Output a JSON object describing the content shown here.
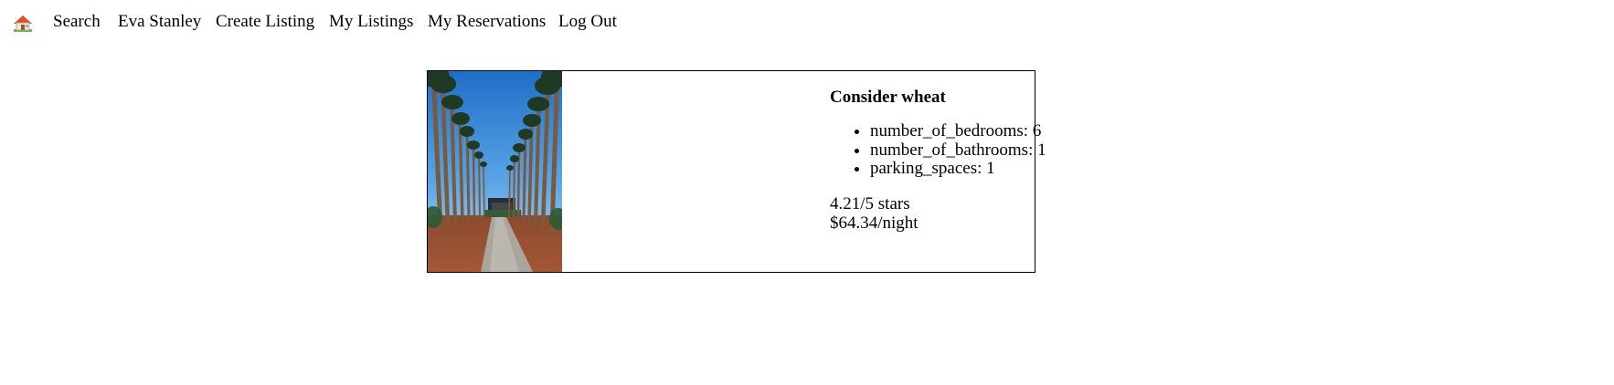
{
  "nav": {
    "home_icon": "home-icon",
    "links": [
      "Search",
      "Eva Stanley",
      "Create Listing",
      "My Listings",
      "My Reservations",
      "Log Out"
    ]
  },
  "listing": {
    "title": "Consider wheat",
    "features": [
      "number_of_bedrooms: 6",
      "number_of_bathrooms: 1",
      "parking_spaces: 1"
    ],
    "rating": "4.21/5 stars",
    "price": "$64.34/night"
  },
  "colors": {
    "sky": "#2f7fd0",
    "palm_trunk": "#7a5a3c",
    "palm_leaf": "#1f3a24",
    "soil": "#9a4f32",
    "path": "#a9a39b",
    "house": "#2a2f32",
    "roof_home": "#e24a2b",
    "grass_home": "#5fbf4a"
  }
}
